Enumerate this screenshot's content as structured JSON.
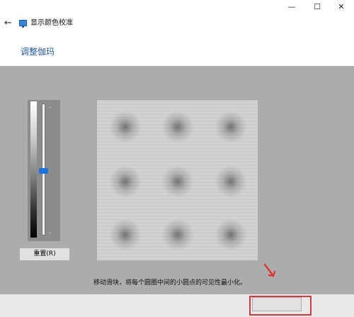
{
  "window": {
    "title": "显示颜色校准",
    "back_glyph": "←",
    "minimize_glyph": "—",
    "maximize_glyph": "☐",
    "close_glyph": "✕"
  },
  "page": {
    "heading": "调整伽玛"
  },
  "gamma": {
    "slider_level": 0.51,
    "reset_label": "重置(R)"
  },
  "instruction": "移动滑块，将每个圆圈中间的小圆点的可见性最小化。",
  "icons": {
    "back": "arrow-left-icon",
    "app": "display-monitor-icon",
    "annotation": "red-arrow-icon"
  },
  "colors": {
    "heading": "#2459a8",
    "slider_thumb": "#1a73d9",
    "panel_bg": "#acacac",
    "annotation": "#d83a3a"
  }
}
